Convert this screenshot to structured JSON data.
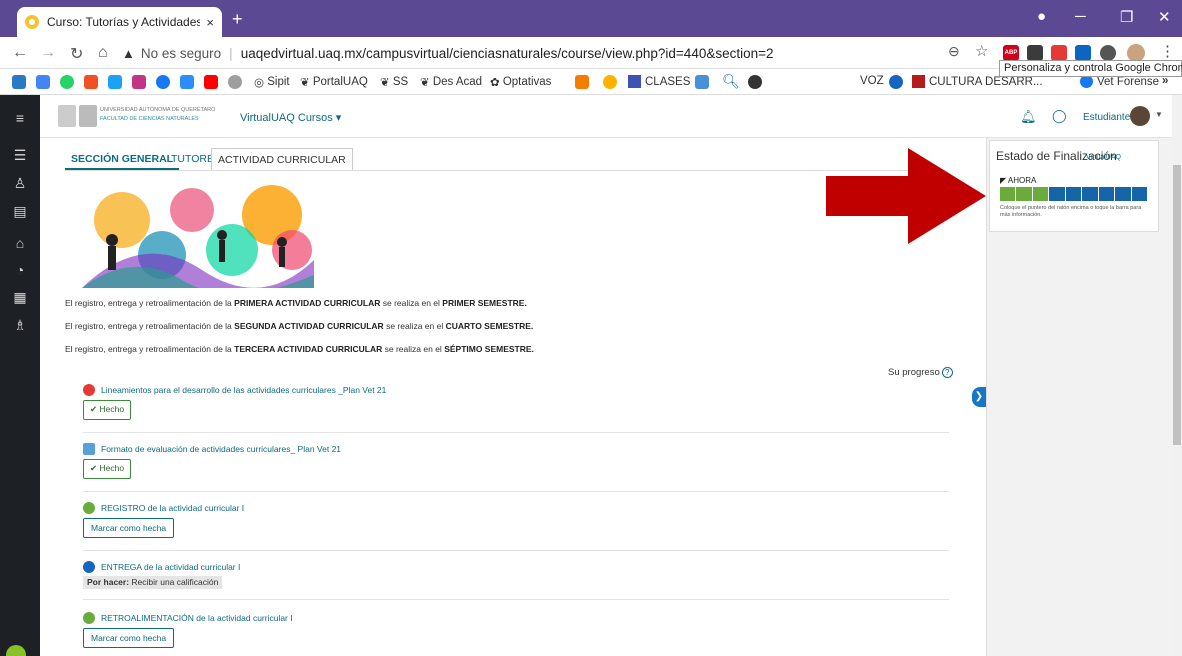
{
  "browser": {
    "tab_title": "Curso: Tutorías y Actividades Cur",
    "tab_close": "×",
    "new_tab": "+",
    "win_min": "─",
    "win_max": "❐",
    "win_close": "✕",
    "security_label": "No es seguro",
    "url": "uaqedvirtual.uaq.mx/campusvirtual/cienciasnaturales/course/view.php?id=440&section=2",
    "tooltip": "Personaliza y controla Google Chrome",
    "ext_abp": "ABP"
  },
  "bookmarks": [
    {
      "label": "Sipit"
    },
    {
      "label": "PortalUAQ"
    },
    {
      "label": "SS"
    },
    {
      "label": "Des Acad"
    },
    {
      "label": "Optativas"
    },
    {
      "label": "CLASES"
    },
    {
      "label": "VOZ"
    },
    {
      "label": "CULTURA DESARR..."
    },
    {
      "label": "Vet Forense"
    }
  ],
  "bookmarks_more": "»",
  "header": {
    "logo_line1": "UNIVERSIDAD AUTÓNOMA DE QUERÉTARO",
    "logo_line2": "FACULTAD DE CIENCIAS NATURALES",
    "nav": "VirtualUAQ   Cursos ▾",
    "user": "Estudiante"
  },
  "tabs": {
    "general": "SECCIÓN GENERAL",
    "tutores": "TUTORES",
    "actividad": "ACTIVIDAD CURRICULAR"
  },
  "paragraphs": {
    "p1_a": "El registro, entrega y retroalimentación de la ",
    "p1_b": "PRIMERA ACTIVIDAD CURRICULAR",
    "p1_c": " se realiza  en el ",
    "p1_d": "PRIMER SEMESTRE.",
    "p2_a": "El registro, entrega y retroalimentación de la  ",
    "p2_b": "SEGUNDA ACTIVIDAD CURRICULAR",
    "p2_c": " se realiza en el ",
    "p2_d": "CUARTO SEMESTRE.",
    "p3_a": "El registro, entrega y retroalimentación de la  ",
    "p3_b": "TERCERA ACTIVIDAD CURRICULAR",
    "p3_c": " se realiza en el ",
    "p3_d": "SÉPTIMO SEMESTRE."
  },
  "progress_label": "Su progreso",
  "progress_help": "?",
  "activities": [
    {
      "title": "Lineamientos para el desarrollo de las actividades curriculares _Plan Vet 21",
      "action": "✔ Hecho"
    },
    {
      "title": "Formato de evaluación de actividades curriculares_ Plan Vet 21",
      "action": "✔ Hecho"
    },
    {
      "title": "REGISTRO de la actividad curricular I",
      "action": "Marcar como hecha"
    },
    {
      "title": "ENTREGA de la actividad curricular I",
      "todo_bold": "Por hacer:",
      "todo_rest": " Recibir una calificación"
    },
    {
      "title": "RETROALIMENTACIÓN de la actividad curricular I",
      "action": "Marcar como hecha"
    }
  ],
  "completion_block": {
    "title": "Estado de Finalización",
    "overlay": "VirtualUAQ",
    "now": "◤ AHORA",
    "hint": "Coloque el puntero del ratón encima o toque la barra para más información.",
    "cells_done": 3,
    "cells_total": 9,
    "color_done": "#6aab3c",
    "color_todo": "#1565a8"
  },
  "colors": {
    "accent": "#0f6b7f",
    "chrome_frame": "#5b4a93",
    "arrow": "#c00000"
  }
}
